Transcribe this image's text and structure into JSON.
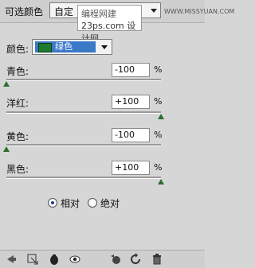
{
  "panel": {
    "title": "可选颜色",
    "preset_value": "自定",
    "watermark_line1": "编程网建",
    "watermark_line2": "23ps.com",
    "watermark_brand": "设计网",
    "corner_text": "WWW.MISSYUAN.COM"
  },
  "color_select": {
    "label": "颜色:",
    "value": "绿色",
    "swatch_color": "#1f7a32"
  },
  "sliders": [
    {
      "label": "青色:",
      "value": "-100",
      "unit": "%",
      "level": 0.0
    },
    {
      "label": "洋红:",
      "value": "+100",
      "unit": "%",
      "level": 1.0
    },
    {
      "label": "黄色:",
      "value": "-100",
      "unit": "%",
      "level": 0.0
    },
    {
      "label": "黑色:",
      "value": "+100",
      "unit": "%",
      "level": 1.0
    }
  ],
  "mode": {
    "relative_label": "相对",
    "absolute_label": "绝对",
    "selected": "relative"
  },
  "toolbar_icons": [
    "back-arrow-icon",
    "clip-layer-icon",
    "visibility-eye-icon",
    "eye-icon",
    "view-previous-state-icon",
    "reset-icon",
    "trash-icon"
  ]
}
